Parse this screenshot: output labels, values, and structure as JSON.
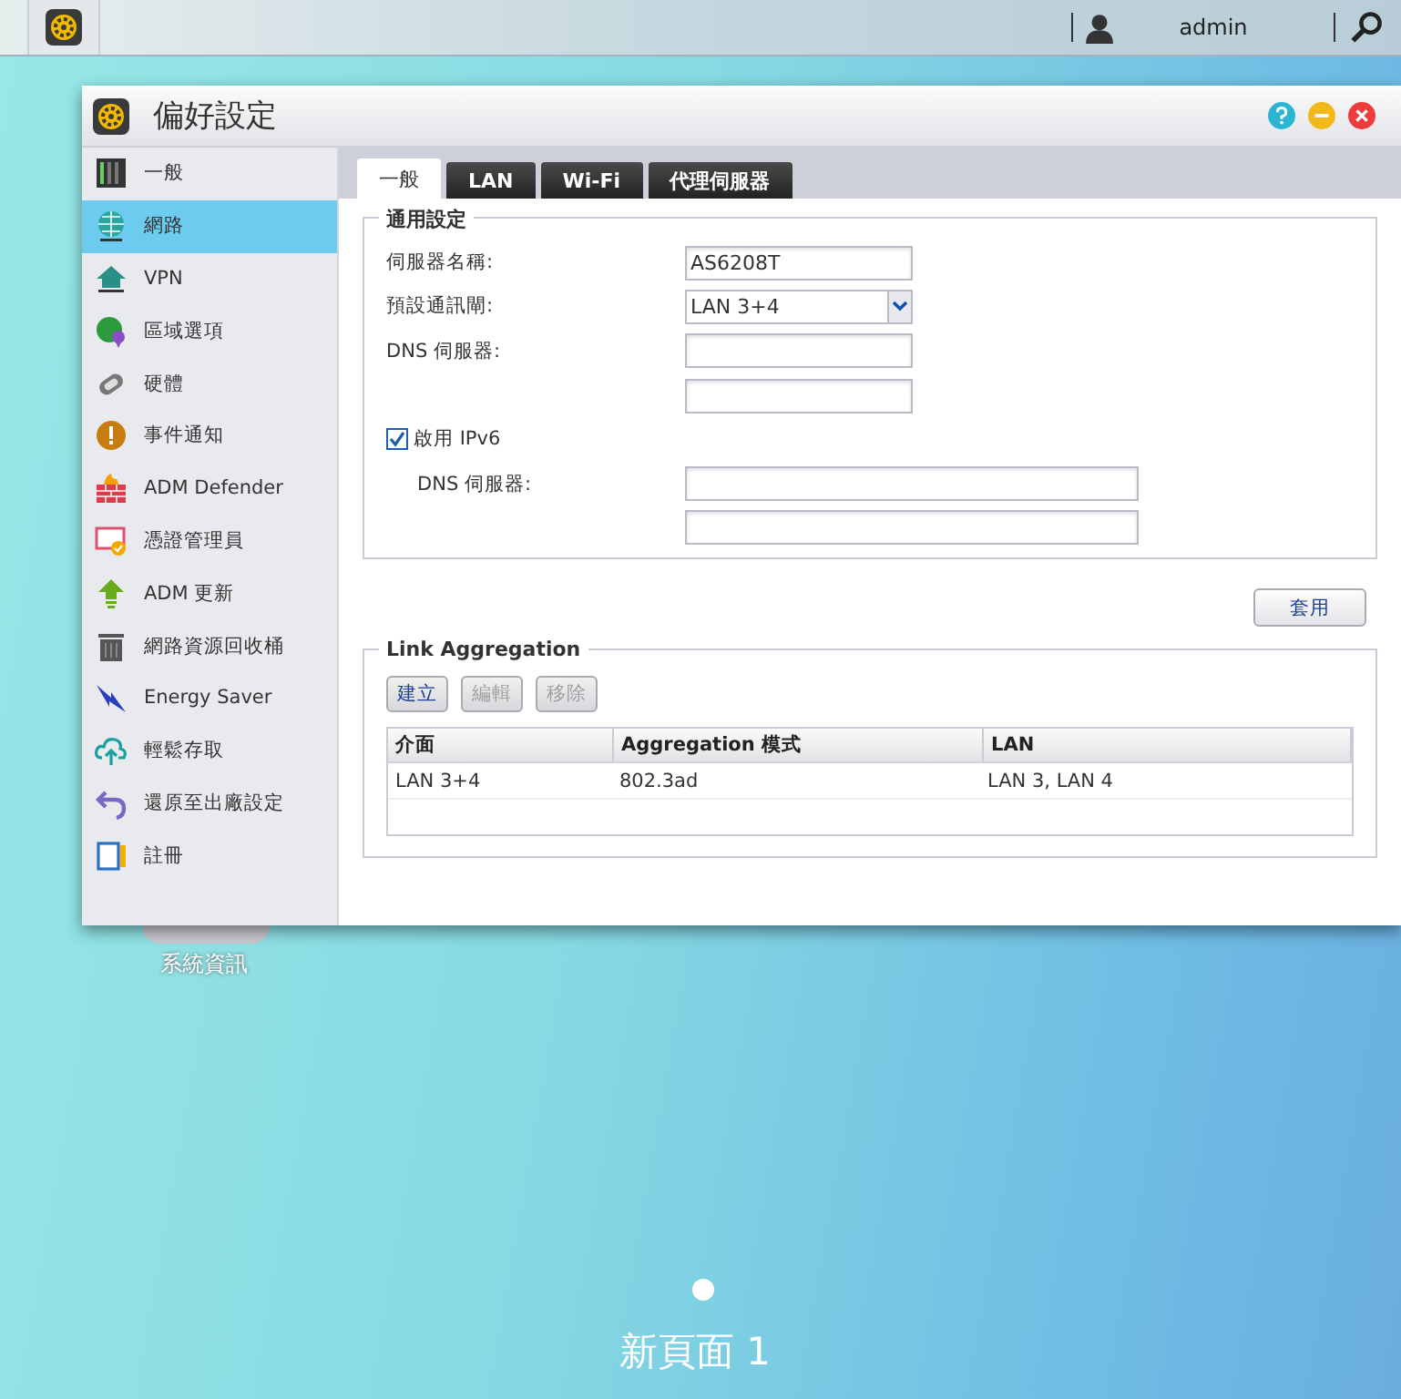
{
  "taskbar": {
    "user": "admin"
  },
  "window": {
    "title": "偏好設定"
  },
  "sidebar": {
    "items": [
      {
        "label": "一般",
        "selected": false
      },
      {
        "label": "網路",
        "selected": true
      },
      {
        "label": "VPN",
        "selected": false
      },
      {
        "label": "區域選項",
        "selected": false
      },
      {
        "label": "硬體",
        "selected": false
      },
      {
        "label": "事件通知",
        "selected": false
      },
      {
        "label": "ADM Defender",
        "selected": false
      },
      {
        "label": "憑證管理員",
        "selected": false
      },
      {
        "label": "ADM 更新",
        "selected": false
      },
      {
        "label": "網路資源回收桶",
        "selected": false
      },
      {
        "label": "Energy Saver",
        "selected": false
      },
      {
        "label": "輕鬆存取",
        "selected": false
      },
      {
        "label": "還原至出廠設定",
        "selected": false
      },
      {
        "label": "註冊",
        "selected": false
      }
    ]
  },
  "tabs": [
    {
      "label": "一般",
      "selected": true
    },
    {
      "label": "LAN",
      "selected": false
    },
    {
      "label": "Wi-Fi",
      "selected": false
    },
    {
      "label": "代理伺服器",
      "selected": false
    }
  ],
  "general": {
    "legend": "通用設定",
    "server_name": {
      "label": "伺服器名稱:",
      "value": "AS6208T"
    },
    "gateway": {
      "label": "預設通訊閘:",
      "value": "LAN 3+4"
    },
    "dns": {
      "label": "DNS 伺服器:"
    },
    "ipv6": {
      "label": "啟用 IPv6",
      "checked": true
    },
    "ipv6_dns": {
      "label": "DNS 伺服器:"
    }
  },
  "apply_button": "套用",
  "link_aggregation": {
    "legend": "Link Aggregation",
    "buttons": [
      {
        "label": "建立",
        "disabled": false
      },
      {
        "label": "編輯",
        "disabled": true
      },
      {
        "label": "移除",
        "disabled": true
      }
    ],
    "table": {
      "columns": [
        "介面",
        "Aggregation 模式",
        "LAN"
      ],
      "rows": [
        [
          "LAN 3+4",
          "802.3ad",
          "LAN 3, LAN 4"
        ]
      ]
    }
  },
  "desktop": {
    "icon_label": "系統資訊",
    "page_label": "新頁面 1"
  }
}
